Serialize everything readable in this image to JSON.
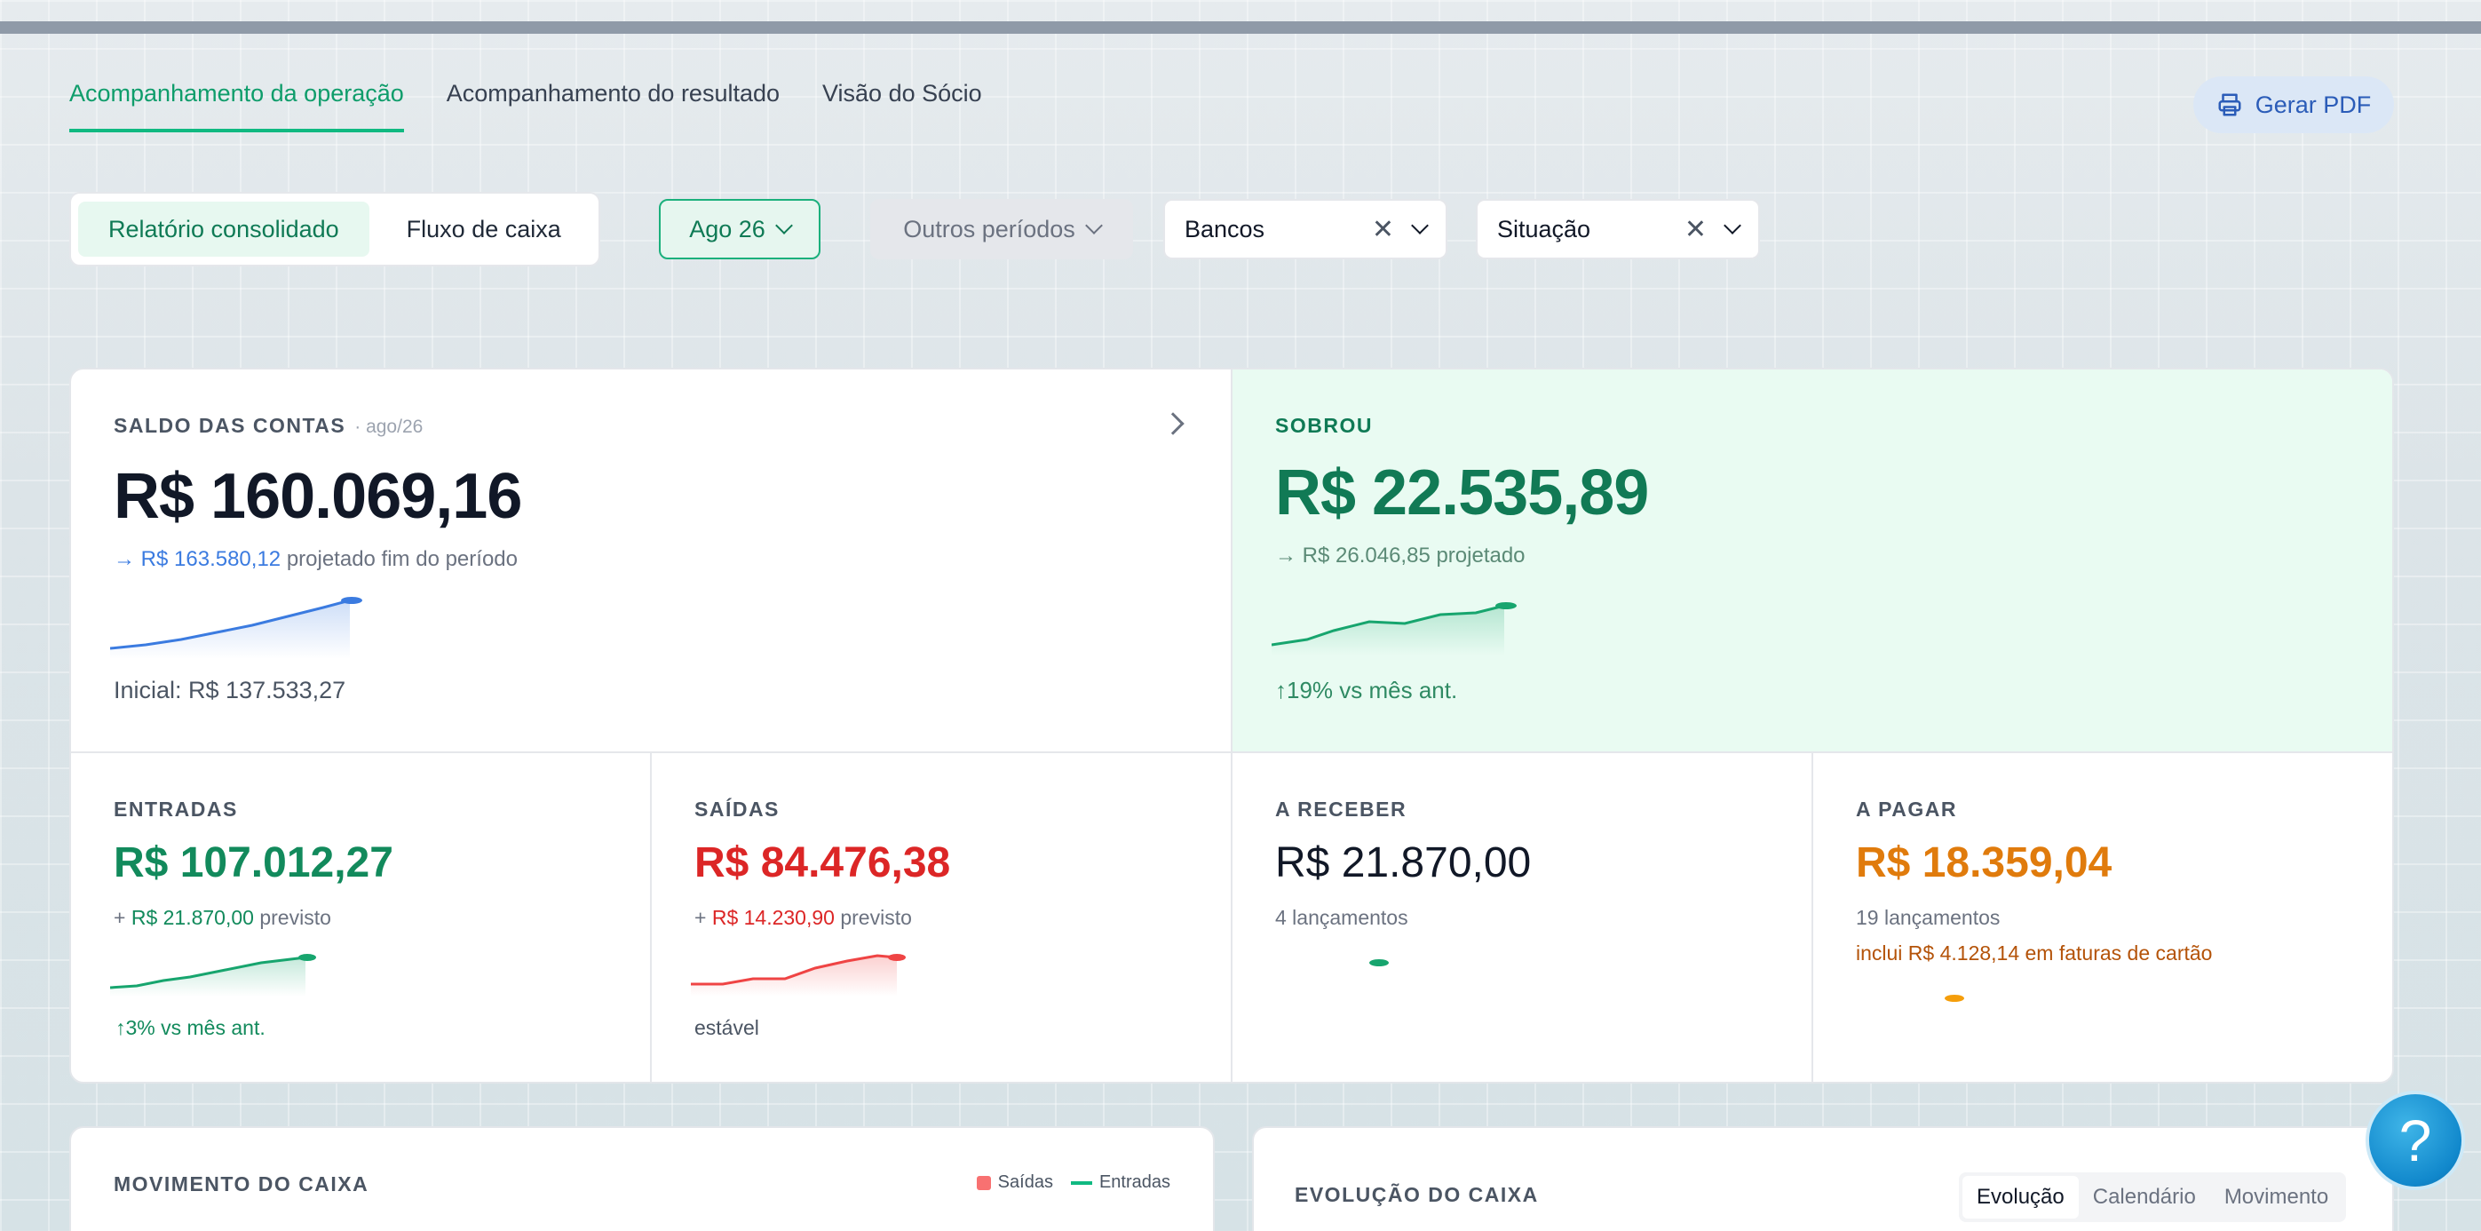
{
  "tabs": [
    {
      "label": "Acompanhamento da operação",
      "active": true
    },
    {
      "label": "Acompanhamento do resultado",
      "active": false
    },
    {
      "label": "Visão do Sócio",
      "active": false
    }
  ],
  "pdf_button": {
    "label": "Gerar PDF",
    "icon": "printer-icon"
  },
  "view_toggle": {
    "options": [
      "Relatório consolidado",
      "Fluxo de caixa"
    ],
    "selected": "Relatório consolidado"
  },
  "filters": {
    "month": "Ago 26",
    "other_periods": "Outros períodos",
    "banks": "Bancos",
    "status": "Situação"
  },
  "saldo": {
    "title": "SALDO DAS CONTAS",
    "period": "· ago/26",
    "value": "R$ 160.069,16",
    "projected_prefix": "→",
    "projected_value": "R$ 163.580,12",
    "projected_suffix": "projetado fim do período",
    "initial": "Inicial: R$ 137.533,27",
    "color": "#3b7be0"
  },
  "sobrou": {
    "title": "SOBROU",
    "value": "R$ 22.535,89",
    "projected": "→ R$ 26.046,85 projetado",
    "comparison": "↑19% vs mês ant.",
    "color": "#17a56e"
  },
  "entradas": {
    "title": "ENTRADAS",
    "value": "R$ 107.012,27",
    "forecast_prefix": "+",
    "forecast_value": "R$ 21.870,00",
    "forecast_suffix": "previsto",
    "comparison": "↑3% vs mês ant.",
    "color": "#128a5c"
  },
  "saidas": {
    "title": "SAÍDAS",
    "value": "R$ 84.476,38",
    "forecast_prefix": "+",
    "forecast_value": "R$ 14.230,90",
    "forecast_suffix": "previsto",
    "comparison": "estável",
    "color": "#dc2626"
  },
  "a_receber": {
    "title": "A RECEBER",
    "value": "R$ 21.870,00",
    "count": "4 lançamentos",
    "color": "#111827"
  },
  "a_pagar": {
    "title": "A PAGAR",
    "value": "R$ 18.359,04",
    "count": "19 lançamentos",
    "note": "inclui R$ 4.128,14 em faturas de cartão",
    "color": "#e07b0c"
  },
  "movimento": {
    "title": "MOVIMENTO DO CAIXA",
    "legend": [
      {
        "label": "Saídas",
        "color": "#f87171"
      },
      {
        "label": "Entradas",
        "color": "#10b981"
      }
    ]
  },
  "evolucao": {
    "title": "EVOLUÇÃO DO CAIXA",
    "toggle": [
      "Evolução",
      "Calendário",
      "Movimento"
    ],
    "selected": "Evolução"
  }
}
